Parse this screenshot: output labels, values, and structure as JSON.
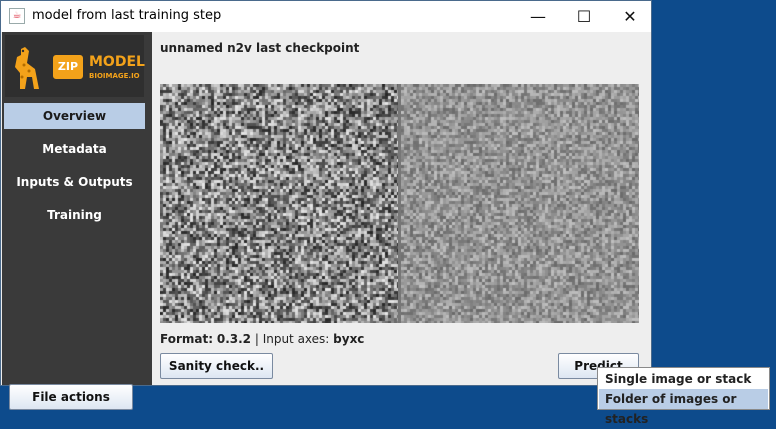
{
  "window": {
    "title": "model from last training step",
    "controls": {
      "minimize": "—",
      "maximize": "☐",
      "close": "✕"
    }
  },
  "logo": {
    "zip_text": "ZIP",
    "model_text": "MODEL",
    "sub_text": "BIOIMAGE.IO"
  },
  "sidebar": {
    "items": [
      {
        "label": "Overview",
        "active": true
      },
      {
        "label": "Metadata",
        "active": false
      },
      {
        "label": "Inputs & Outputs",
        "active": false
      },
      {
        "label": "Training",
        "active": false
      }
    ],
    "file_actions_label": "File actions"
  },
  "main": {
    "model_name": "unnamed n2v last checkpoint",
    "format_label": "Format:",
    "format_value": "0.3.2",
    "separator": " | Input axes: ",
    "axes_value": "byxc",
    "sanity_check_label": "Sanity check..",
    "predict_label": "Predict"
  },
  "popup": {
    "items": [
      {
        "label": "Single image or stack"
      },
      {
        "label": "Folder of images or stacks"
      }
    ]
  },
  "colors": {
    "desktop": "#0d4b8c",
    "sidebar": "#3a3a3a",
    "active_nav": "#b9cde6",
    "logo_accent": "#f3a21a"
  }
}
